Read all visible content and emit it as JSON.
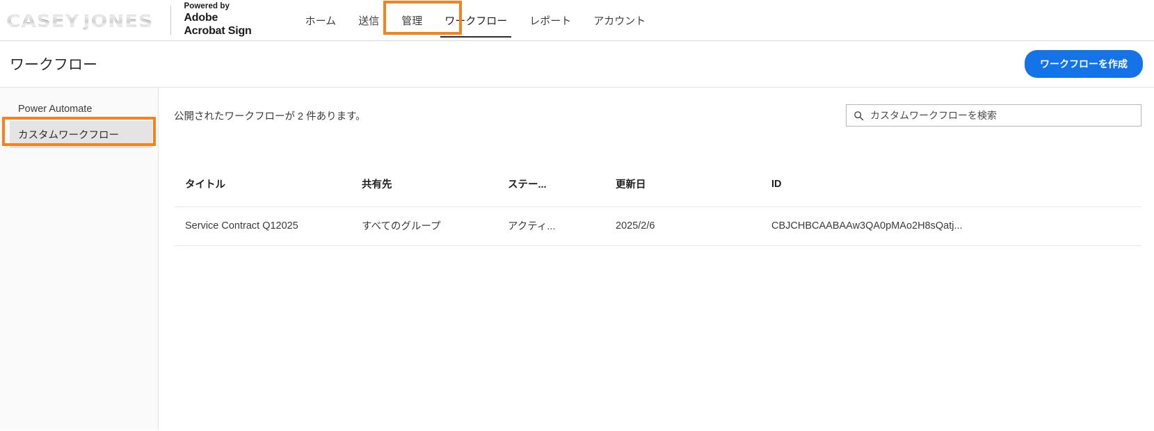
{
  "branding": {
    "company_logo_words": [
      "CASEY",
      "JONES"
    ],
    "powered_by": "Powered by",
    "product_line1": "Adobe",
    "product_line2": "Acrobat Sign"
  },
  "nav": {
    "items": [
      {
        "label": "ホーム",
        "active": false
      },
      {
        "label": "送信",
        "active": false
      },
      {
        "label": "管理",
        "active": false
      },
      {
        "label": "ワークフロー",
        "active": true
      },
      {
        "label": "レポート",
        "active": false
      },
      {
        "label": "アカウント",
        "active": false
      }
    ]
  },
  "header": {
    "page_title": "ワークフロー",
    "create_button": "ワークフローを作成"
  },
  "sidebar": {
    "items": [
      {
        "label": "Power Automate",
        "selected": false
      },
      {
        "label": "カスタムワークフロー",
        "selected": true
      }
    ]
  },
  "content": {
    "count_text": "公開されたワークフローが 2 件あります。",
    "search": {
      "placeholder": "カスタムワークフローを検索",
      "value": "",
      "icon": "search-icon"
    },
    "table": {
      "columns": [
        "タイトル",
        "共有先",
        "ステー...",
        "更新日",
        "ID"
      ],
      "rows": [
        {
          "title": "Service Contract Q12025",
          "shared_with": "すべてのグループ",
          "status": "アクティ...",
          "updated": "2025/2/6",
          "id": "CBJCHBCAABAAw3QA0pMAo2H8sQatj..."
        }
      ]
    }
  },
  "annotations": {
    "accent_color": "#f58220",
    "nav_highlight_target": "ワークフロー",
    "sidebar_highlight_target": "カスタムワークフロー"
  }
}
